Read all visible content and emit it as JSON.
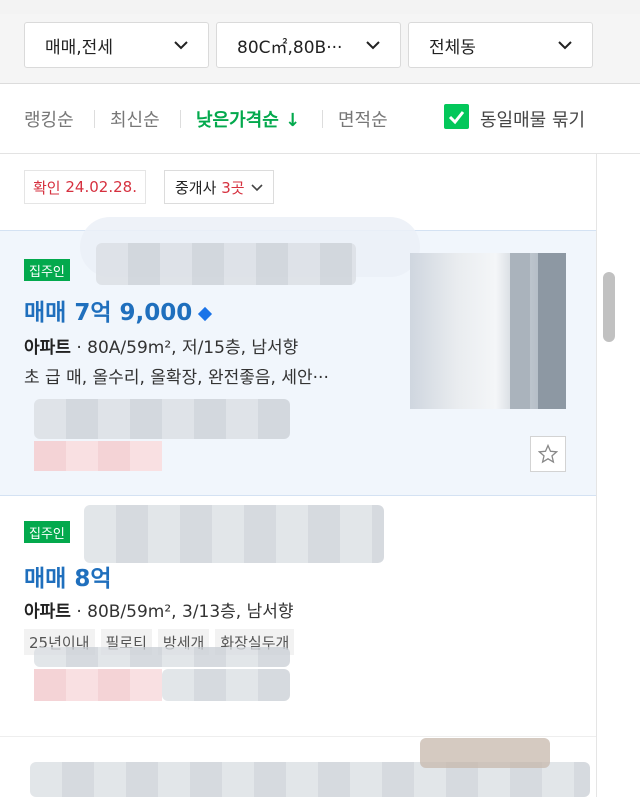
{
  "filters": {
    "deal_type": "매매,전세",
    "area": "80C㎡,80B···",
    "region": "전체동"
  },
  "sort": {
    "ranking": "랭킹순",
    "newest": "최신순",
    "low_price": "낮은가격순",
    "low_price_arrow": "↓",
    "area": "면적순",
    "group_label": "동일매물 묶기",
    "group_checked": true
  },
  "info": {
    "confirm_prefix": "확인",
    "confirm_date": "24.02.28.",
    "agents_label": "중개사",
    "agents_count": "3곳"
  },
  "listings": [
    {
      "owner_tag": "집주인",
      "price": "매매 7억 9,000",
      "type": "아파트",
      "spec": "80A/59m², 저/15층, 남서향",
      "desc": "초 급 매, 올수리, 올확장, 완전좋음, 세안···"
    },
    {
      "owner_tag": "집주인",
      "price": "매매 8억",
      "type": "아파트",
      "spec": "80B/59m², 3/13층, 남서향",
      "tags": [
        "25년이내",
        "필로티",
        "방세개",
        "화장실두개"
      ]
    }
  ],
  "colors": {
    "accent_green": "#03c75a",
    "price_blue": "#1f6fbd",
    "confirm_red": "#d6313f",
    "highlight_bg": "#f1f6fc"
  }
}
